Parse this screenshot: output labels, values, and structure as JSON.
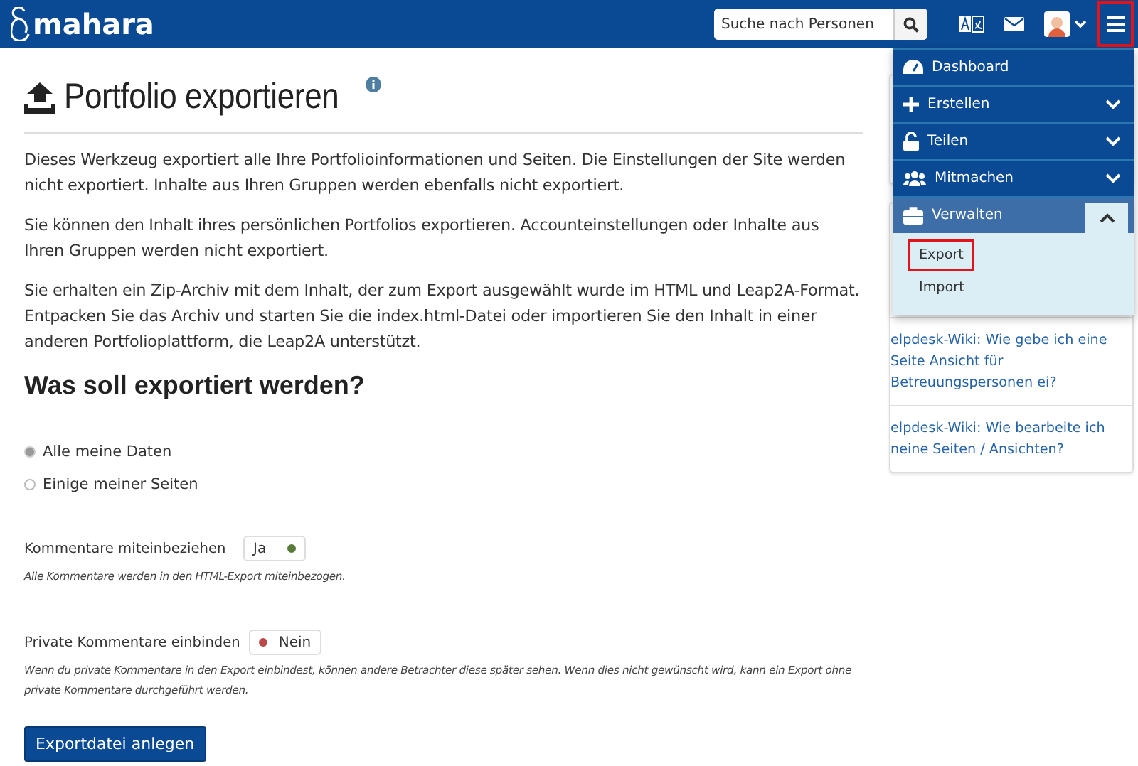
{
  "header": {
    "logo": "mahara",
    "search": {
      "placeholder": "Suche nach Personen"
    },
    "menu_button": {
      "highlighted": true
    }
  },
  "page": {
    "title": "Portfolio exportieren",
    "paragraphs": [
      "Dieses Werkzeug exportiert alle Ihre Portfolioinformationen und Seiten. Die Einstellungen der Site werden nicht exportiert. Inhalte aus Ihren Gruppen werden ebenfalls nicht exportiert.",
      "Sie können den Inhalt ihres persönlichen Portfolios exportieren. Accounteinstellungen oder Inhalte aus Ihren Gruppen werden nicht exportiert.",
      "Sie erhalten ein Zip-Archiv mit dem Inhalt, der zum Export ausgewählt wurde im HTML und Leap2A-Format. Entpacken Sie das Archiv und starten Sie die index.html-Datei oder importieren Sie den Inhalt in einer anderen Portfolioplattform, die Leap2A unterstützt."
    ],
    "question": "Was soll exportiert werden?",
    "options": [
      {
        "label": "Alle meine Daten",
        "selected": true
      },
      {
        "label": "Einige meiner Seiten",
        "selected": false
      }
    ],
    "switches": [
      {
        "label": "Kommentare miteinbeziehen",
        "value": "Ja",
        "on": true,
        "hint": "Alle Kommentare werden in den HTML-Export miteinbezogen."
      },
      {
        "label": "Private Kommentare einbinden",
        "value": "Nein",
        "on": false,
        "hint": "Wenn du private Kommentare in den Export einbindest, können andere Betrachter diese später sehen. Wenn dies nicht gewünscht wird, kann ein Export ohne private Kommentare durchgeführt werden."
      }
    ],
    "submit": "Exportdatei anlegen"
  },
  "sidebar": {
    "links": [
      "elpdesk-Wiki: Wie gebe ich eine Seite Ansicht für Betreuungspersonen ei?",
      "elpdesk-Wiki: Wie bearbeite ich neine Seiten / Ansichten?"
    ]
  },
  "menu": {
    "items": [
      {
        "kind": "link",
        "label": "Dashboard"
      },
      {
        "kind": "group",
        "label": "Erstellen",
        "expanded": false
      },
      {
        "kind": "group",
        "label": "Teilen",
        "expanded": false
      },
      {
        "kind": "group",
        "label": "Mitmachen",
        "expanded": false
      },
      {
        "kind": "group",
        "label": "Verwalten",
        "expanded": true,
        "children": [
          {
            "label": "Export",
            "highlighted": true
          },
          {
            "label": "Import",
            "highlighted": false
          }
        ]
      }
    ]
  }
}
